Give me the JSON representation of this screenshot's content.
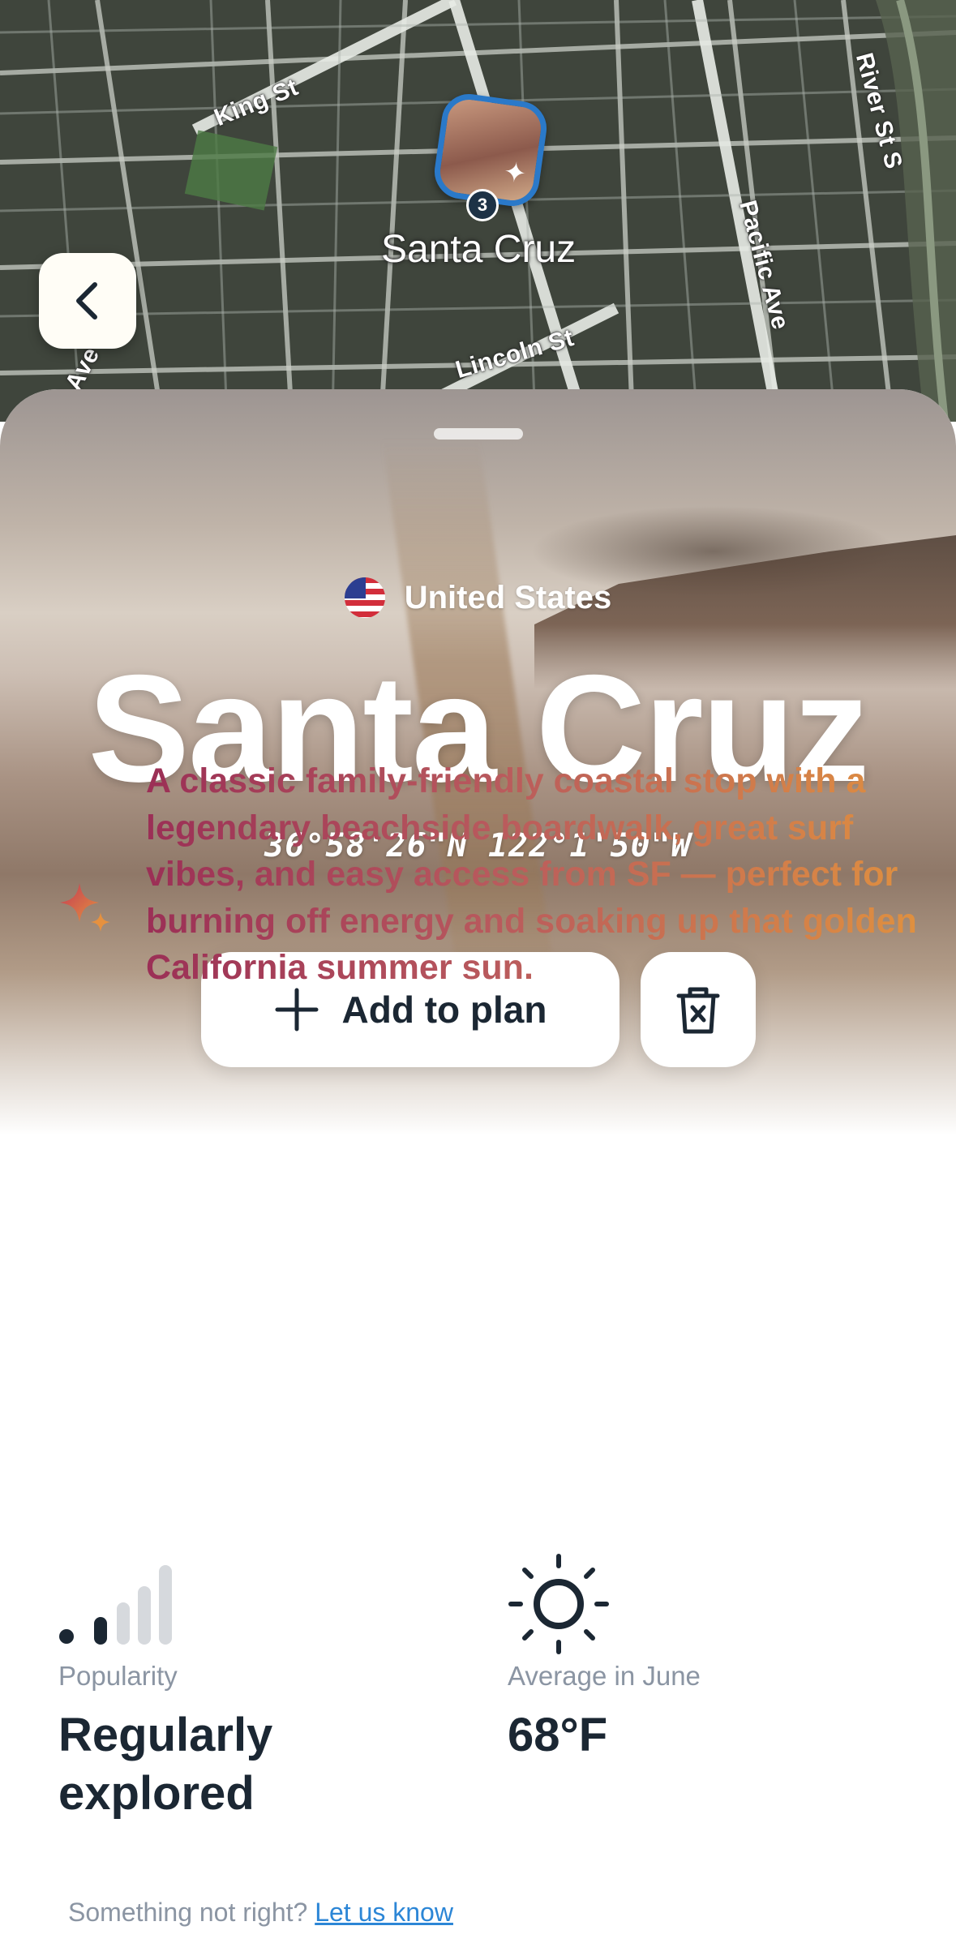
{
  "map": {
    "streets": [
      "King St",
      "Lincoln St",
      "Pacific Ave",
      "River St S",
      "d Ave"
    ],
    "pin_count": "3",
    "city_label": "Santa Cruz"
  },
  "place": {
    "country": "United States",
    "name": "Santa Cruz",
    "coordinates": "36°58'26\"N  122°1'50\"W"
  },
  "actions": {
    "add_label": "Add to plan"
  },
  "description": "A classic family-friendly coastal stop with a legendary beachside boardwalk, great surf vibes, and easy access from SF — perfect for burning off energy and soaking up that golden California summer sun.",
  "stats": {
    "popularity": {
      "label": "Popularity",
      "value": "Regularly explored",
      "level": 2,
      "max_level": 5
    },
    "weather": {
      "label": "Average in June",
      "value": "68°F"
    }
  },
  "feedback": {
    "prompt": "Something not right?",
    "link": "Let us know"
  },
  "colors": {
    "accent_blue": "#2a79c9",
    "text_dark": "#1b2733",
    "text_muted": "#8b95a3",
    "gradient_start": "#9b2f56",
    "gradient_end": "#e0913f",
    "link": "#2c86d6"
  }
}
